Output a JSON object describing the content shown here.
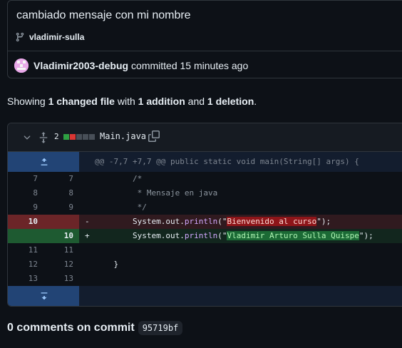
{
  "commit": {
    "title": "cambiado mensaje con mi nombre",
    "branch": "vladimir-sulla",
    "author": "Vladimir2003-debug",
    "action": "committed 15 minutes ago"
  },
  "summary": {
    "prefix": "Showing ",
    "changed": "1 changed file",
    "with": " with ",
    "additions": "1 addition",
    "and": " and ",
    "deletions": "1 deletion",
    "suffix": "."
  },
  "file": {
    "change_count": "2",
    "name": "Main.java",
    "diffstat_colors": [
      "#2ea043",
      "#da3633",
      "#484f58",
      "#484f58",
      "#484f58"
    ]
  },
  "hunk_header": "@@ -7,7 +7,7 @@ public static void main(String[] args) {",
  "lines": [
    {
      "old": "7",
      "new": "7",
      "sign": "",
      "type": "ctx"
    },
    {
      "old": "8",
      "new": "8",
      "sign": "",
      "type": "ctx"
    },
    {
      "old": "9",
      "new": "9",
      "sign": "",
      "type": "ctx"
    },
    {
      "old": "10",
      "new": "",
      "sign": "-",
      "type": "del"
    },
    {
      "old": "",
      "new": "10",
      "sign": "+",
      "type": "add"
    },
    {
      "old": "11",
      "new": "11",
      "sign": "",
      "type": "ctx"
    },
    {
      "old": "12",
      "new": "12",
      "sign": "",
      "type": "ctx"
    },
    {
      "old": "13",
      "new": "13",
      "sign": "",
      "type": "ctx"
    }
  ],
  "code": {
    "l7": "/*",
    "l8": " * Mensaje en java",
    "l9": " */",
    "del_pre": "System.out.",
    "del_fn": "println",
    "del_open": "(\"",
    "del_str": "Bienvenido al curso",
    "del_close": "\");",
    "add_pre": "System.out.",
    "add_fn": "println",
    "add_open": "(\"",
    "add_str": "Vladimir Arturo Sulla Quispe",
    "add_close": "\");",
    "l12": "}",
    "l13": ""
  },
  "comments": {
    "label": "0 comments on commit",
    "sha": "95719bf"
  }
}
